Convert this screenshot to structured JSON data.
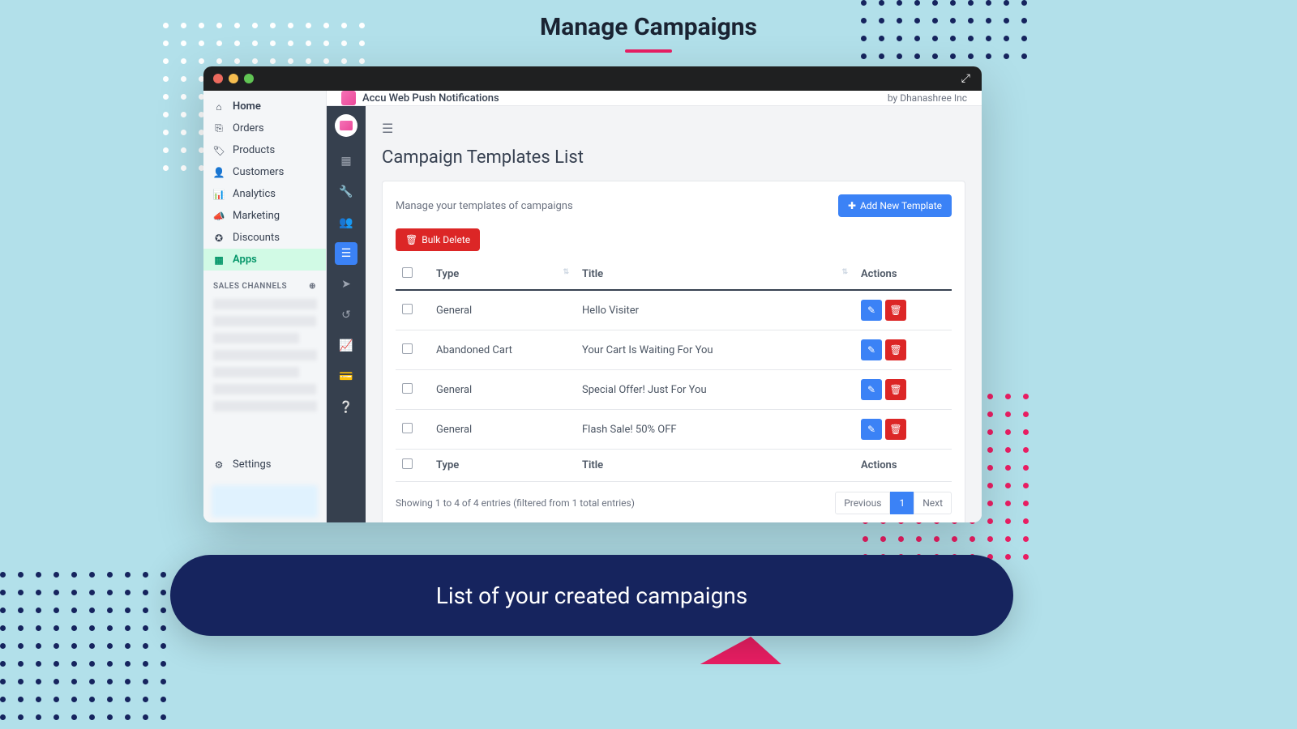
{
  "page_title": "Manage Campaigns",
  "bottom_caption": "List of your created campaigns",
  "appbar": {
    "title": "Accu Web Push Notifications",
    "by": "by Dhanashree Inc"
  },
  "leftnav": {
    "items": [
      {
        "label": "Home"
      },
      {
        "label": "Orders"
      },
      {
        "label": "Products"
      },
      {
        "label": "Customers"
      },
      {
        "label": "Analytics"
      },
      {
        "label": "Marketing"
      },
      {
        "label": "Discounts"
      },
      {
        "label": "Apps"
      }
    ],
    "channels_head": "SALES CHANNELS",
    "settings": "Settings"
  },
  "main": {
    "heading": "Campaign Templates List",
    "subtitle": "Manage your templates of campaigns",
    "add_btn": "Add New Template",
    "bulk_delete": "Bulk Delete",
    "columns": {
      "type": "Type",
      "title": "Title",
      "actions": "Actions"
    },
    "rows": [
      {
        "type": "General",
        "title": "Hello Visiter"
      },
      {
        "type": "Abandoned Cart",
        "title": "Your Cart Is Waiting For You"
      },
      {
        "type": "General",
        "title": "Special Offer! Just For You"
      },
      {
        "type": "General",
        "title": "Flash Sale! 50% OFF"
      }
    ],
    "footer_info": "Showing 1 to 4 of 4 entries (filtered from 1 total entries)",
    "pager": {
      "prev": "Previous",
      "page": "1",
      "next": "Next"
    }
  }
}
